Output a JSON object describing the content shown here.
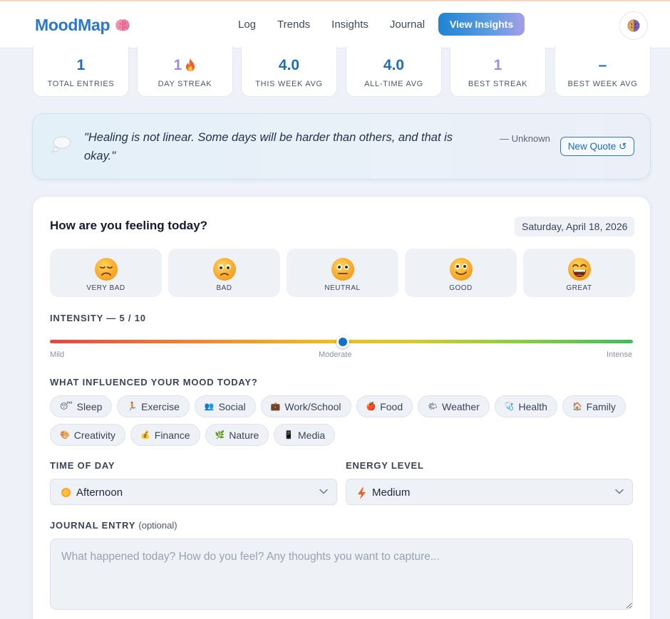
{
  "app": {
    "brand": "MoodMap",
    "brand_icon": "brain-icon"
  },
  "nav": {
    "links": [
      "Log",
      "Trends",
      "Insights",
      "Journal"
    ],
    "cta_label": "View Insights",
    "avatar_icon": "brain-icon"
  },
  "stats": [
    {
      "value": "1",
      "label": "TOTAL ENTRIES",
      "accent": "#1b6fb8"
    },
    {
      "value": "1",
      "label": "DAY STREAK",
      "icon": "fire-icon",
      "accent": "#9b8fe0"
    },
    {
      "value": "4.0",
      "label": "THIS WEEK AVG",
      "accent": "#1b6fb8"
    },
    {
      "value": "4.0",
      "label": "ALL-TIME AVG",
      "accent": "#1b6fb8"
    },
    {
      "value": "1",
      "label": "BEST STREAK",
      "accent": "#9b8fe0"
    },
    {
      "value": "–",
      "label": "BEST WEEK AVG",
      "accent": "#1b6fb8"
    }
  ],
  "quote": {
    "icon": "thought-bubble-icon",
    "text": "\"Healing is not linear. Some days will be harder than others, and that is okay.\"",
    "author": "— Unknown",
    "button_label": "New Quote ↺"
  },
  "form": {
    "title": "How are you feeling today?",
    "date": "Saturday, April 18, 2026",
    "moods": [
      {
        "label": "VERY BAD",
        "icon": "very-bad-face-icon"
      },
      {
        "label": "BAD",
        "icon": "bad-face-icon"
      },
      {
        "label": "NEUTRAL",
        "icon": "neutral-face-icon"
      },
      {
        "label": "GOOD",
        "icon": "good-face-icon"
      },
      {
        "label": "GREAT",
        "icon": "great-face-icon"
      }
    ],
    "intensity": {
      "label": "INTENSITY — 5 / 10",
      "value": 5,
      "max": 10,
      "scale": [
        "Mild",
        "Moderate",
        "Intense"
      ]
    },
    "influence_label": "WHAT INFLUENCED YOUR MOOD TODAY?",
    "influences": [
      {
        "label": "Sleep",
        "icon": "😴"
      },
      {
        "label": "Exercise",
        "icon": "🏃"
      },
      {
        "label": "Social",
        "icon": "👥"
      },
      {
        "label": "Work/School",
        "icon": "💼"
      },
      {
        "label": "Food",
        "icon": "🍎"
      },
      {
        "label": "Weather",
        "icon": "🌤"
      },
      {
        "label": "Health",
        "icon": "🩺"
      },
      {
        "label": "Family",
        "icon": "🏠"
      },
      {
        "label": "Creativity",
        "icon": "🎨"
      },
      {
        "label": "Finance",
        "icon": "💰"
      },
      {
        "label": "Nature",
        "icon": "🌿"
      },
      {
        "label": "Media",
        "icon": "📱"
      }
    ],
    "time_of_day": {
      "label": "TIME OF DAY",
      "value": "Afternoon",
      "icon": "sun-icon"
    },
    "energy": {
      "label": "ENERGY LEVEL",
      "value": "Medium",
      "icon": "lightning-icon"
    },
    "journal": {
      "label": "JOURNAL ENTRY",
      "optional": "(optional)",
      "placeholder": "What happened today? How do you feel? Any thoughts you want to capture..."
    }
  }
}
